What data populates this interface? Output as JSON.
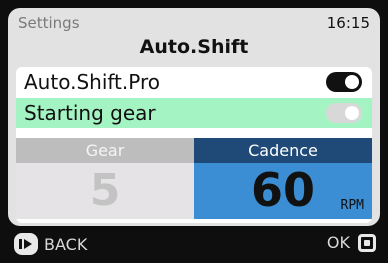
{
  "header": {
    "breadcrumb": "Settings",
    "time": "16:15",
    "title": "Auto.Shift"
  },
  "settings": [
    {
      "label": "Auto.Shift.Pro",
      "enabled": true
    },
    {
      "label": "Starting gear",
      "enabled": false,
      "highlighted": true
    }
  ],
  "metrics": {
    "gear": {
      "label": "Gear",
      "value": "5"
    },
    "cadence": {
      "label": "Cadence",
      "value": "60",
      "unit": "RPM"
    }
  },
  "footer": {
    "back_label": "BACK",
    "ok_label": "OK"
  },
  "colors": {
    "highlight_row": "#a4f3c2",
    "cadence_header": "#1f4a77",
    "cadence_body": "#3b8ed3"
  },
  "icons": {
    "back": "back-button-icon",
    "ok": "ok-button-icon"
  }
}
